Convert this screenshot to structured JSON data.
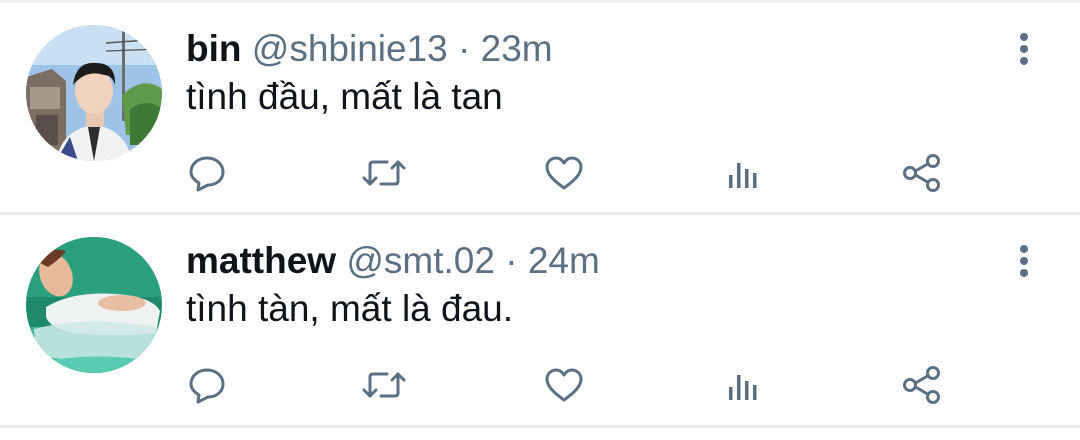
{
  "colors": {
    "text": "#0f1419",
    "secondary": "#5b7083",
    "divider": "#e7eaed",
    "background": "#ffffff"
  },
  "tweets": [
    {
      "name": "bin",
      "handle": "@shbinie13",
      "separator": "·",
      "time": "23m",
      "text": "tình đầu, mất là tan",
      "avatar": "photo-person-outdoors",
      "icons": [
        "reply-icon",
        "retweet-icon",
        "like-icon",
        "analytics-icon",
        "share-icon",
        "more-options-icon"
      ]
    },
    {
      "name": "matthew",
      "handle": "@smt.02",
      "separator": "·",
      "time": "24m",
      "text": "tình tàn, mất là đau.",
      "avatar": "photo-person-in-water",
      "icons": [
        "reply-icon",
        "retweet-icon",
        "like-icon",
        "analytics-icon",
        "share-icon",
        "more-options-icon"
      ]
    }
  ]
}
